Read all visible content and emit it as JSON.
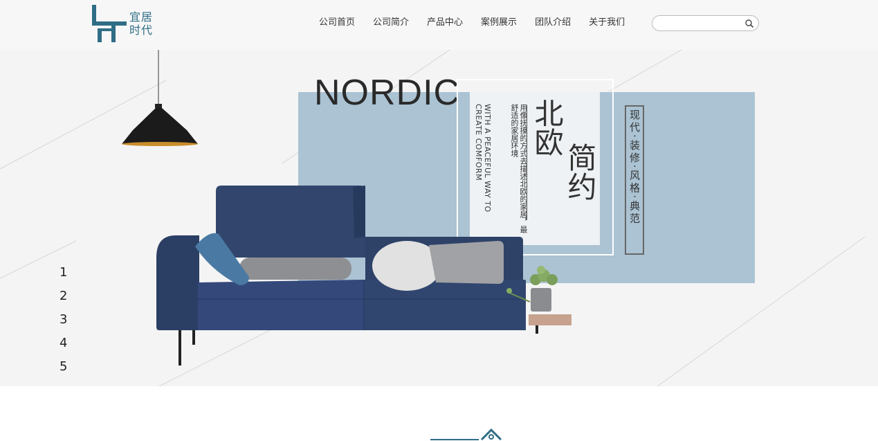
{
  "header": {
    "logo": {
      "line1": "宜居",
      "line2": "时代",
      "color": "#2f6d86"
    },
    "nav": [
      {
        "label": "公司首页"
      },
      {
        "label": "公司简介"
      },
      {
        "label": "产品中心"
      },
      {
        "label": "案例展示"
      },
      {
        "label": "团队介绍"
      },
      {
        "label": "关于我们"
      }
    ],
    "search": {
      "placeholder": "",
      "icon": "search-icon"
    }
  },
  "hero": {
    "heading_en": "NORDIC",
    "heading_cn_1": "北欧",
    "heading_cn_2": "简约",
    "desc_cn": "用像抚摸的方式去描述北欧的家居，最舒适的家居环境",
    "desc_en": "WITH A PEACEFUL WAY TO CREATE COMFORM",
    "tag": "现代·装修·风格·典范",
    "slides": [
      "1",
      "2",
      "3",
      "4",
      "5"
    ],
    "colors": {
      "panel": "#abc3d3",
      "background": "#f4f4f4",
      "sofa": "#30446b"
    }
  }
}
